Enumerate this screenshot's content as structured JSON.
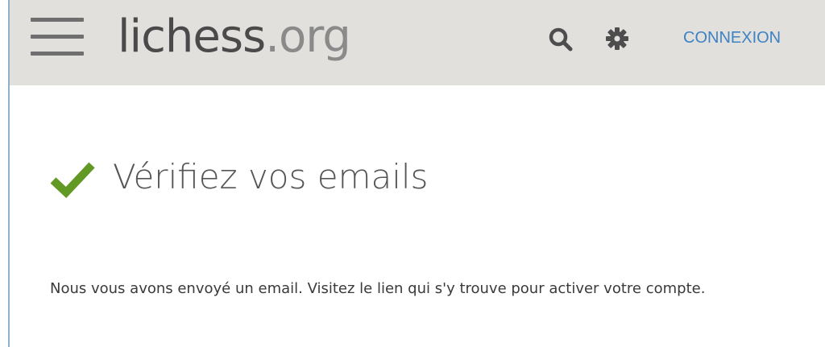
{
  "header": {
    "logo_main": "lichess",
    "logo_tld": ".org",
    "menu_icon": "hamburger-menu-icon",
    "search_icon": "search-icon",
    "settings_icon": "gear-icon",
    "signin_label": "CONNEXION"
  },
  "main": {
    "status_icon": "checkmark-icon",
    "title": "Vérifiez vos emails",
    "message": "Nous vous avons envoyé un email. Visitez le lien qui s'y trouve pour activer votre compte."
  },
  "colors": {
    "header_bg": "#e2e0dd",
    "link_blue": "#3d83c4",
    "check_green": "#629924",
    "icon_gray": "#4d4d4d"
  }
}
